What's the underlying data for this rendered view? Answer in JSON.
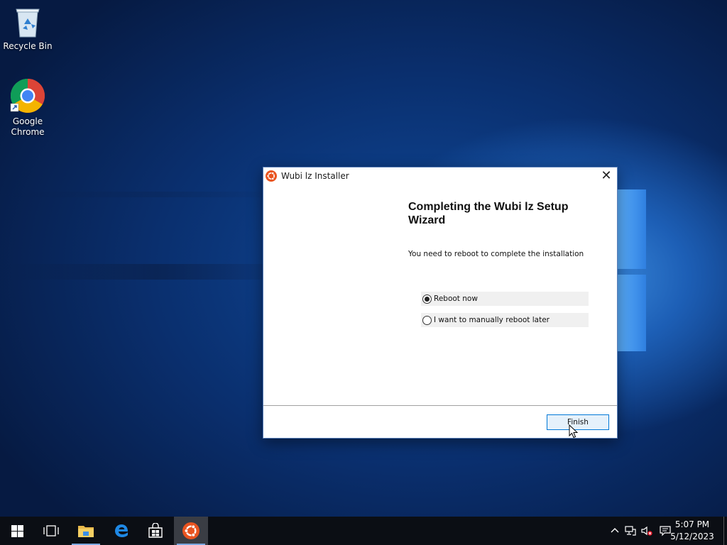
{
  "desktop": {
    "icons": [
      {
        "label": "Recycle Bin",
        "icon": "recycle-bin-icon"
      },
      {
        "label": "Google\nChrome",
        "icon": "chrome-icon"
      }
    ]
  },
  "dialog": {
    "title": "Wubi lz Installer",
    "heading": "Completing the Wubi lz Setup Wizard",
    "message": "You need to reboot to complete the installation",
    "options": [
      {
        "label": "Reboot now",
        "checked": true
      },
      {
        "label": "I want to manually reboot later",
        "checked": false
      }
    ],
    "finish_label": "Finish",
    "close_glyph": "✕"
  },
  "taskbar": {
    "items": [
      "start-icon",
      "task-view-icon",
      "file-explorer-icon",
      "edge-icon",
      "store-icon",
      "ubuntu-icon"
    ],
    "clock": {
      "time": "5:07 PM",
      "date": "5/12/2023"
    }
  },
  "colors": {
    "accent": "#0078d7",
    "ubuntu": "#e95420",
    "taskbar": "#0b0e14"
  }
}
